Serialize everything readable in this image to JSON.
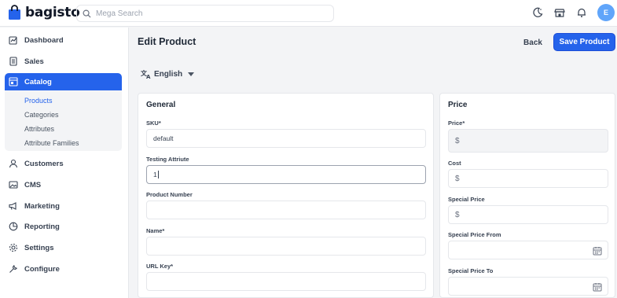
{
  "brand": {
    "name": "bagisto"
  },
  "search": {
    "placeholder": "Mega Search"
  },
  "user": {
    "initial": "E"
  },
  "sidebar": {
    "items": [
      {
        "label": "Dashboard"
      },
      {
        "label": "Sales"
      },
      {
        "label": "Catalog"
      },
      {
        "label": "Customers"
      },
      {
        "label": "CMS"
      },
      {
        "label": "Marketing"
      },
      {
        "label": "Reporting"
      },
      {
        "label": "Settings"
      },
      {
        "label": "Configure"
      }
    ],
    "catalog_sub": [
      {
        "label": "Products"
      },
      {
        "label": "Categories"
      },
      {
        "label": "Attributes"
      },
      {
        "label": "Attribute Families"
      }
    ]
  },
  "page": {
    "title": "Edit Product",
    "back_label": "Back",
    "save_label": "Save Product",
    "locale": "English"
  },
  "general": {
    "title": "General",
    "sku": {
      "label": "SKU*",
      "value": "default"
    },
    "testing": {
      "label": "Testing Attriute",
      "value": "1"
    },
    "product_number": {
      "label": "Product Number",
      "value": ""
    },
    "name": {
      "label": "Name*",
      "value": ""
    },
    "url_key": {
      "label": "URL Key*",
      "value": ""
    }
  },
  "price": {
    "title": "Price",
    "currency_symbol": "$",
    "price": {
      "label": "Price*"
    },
    "cost": {
      "label": "Cost"
    },
    "special_price": {
      "label": "Special Price"
    },
    "special_from": {
      "label": "Special Price From"
    },
    "special_to": {
      "label": "Special Price To"
    }
  },
  "colors": {
    "accent": "#2563eb",
    "avatar": "#60a5fa"
  }
}
